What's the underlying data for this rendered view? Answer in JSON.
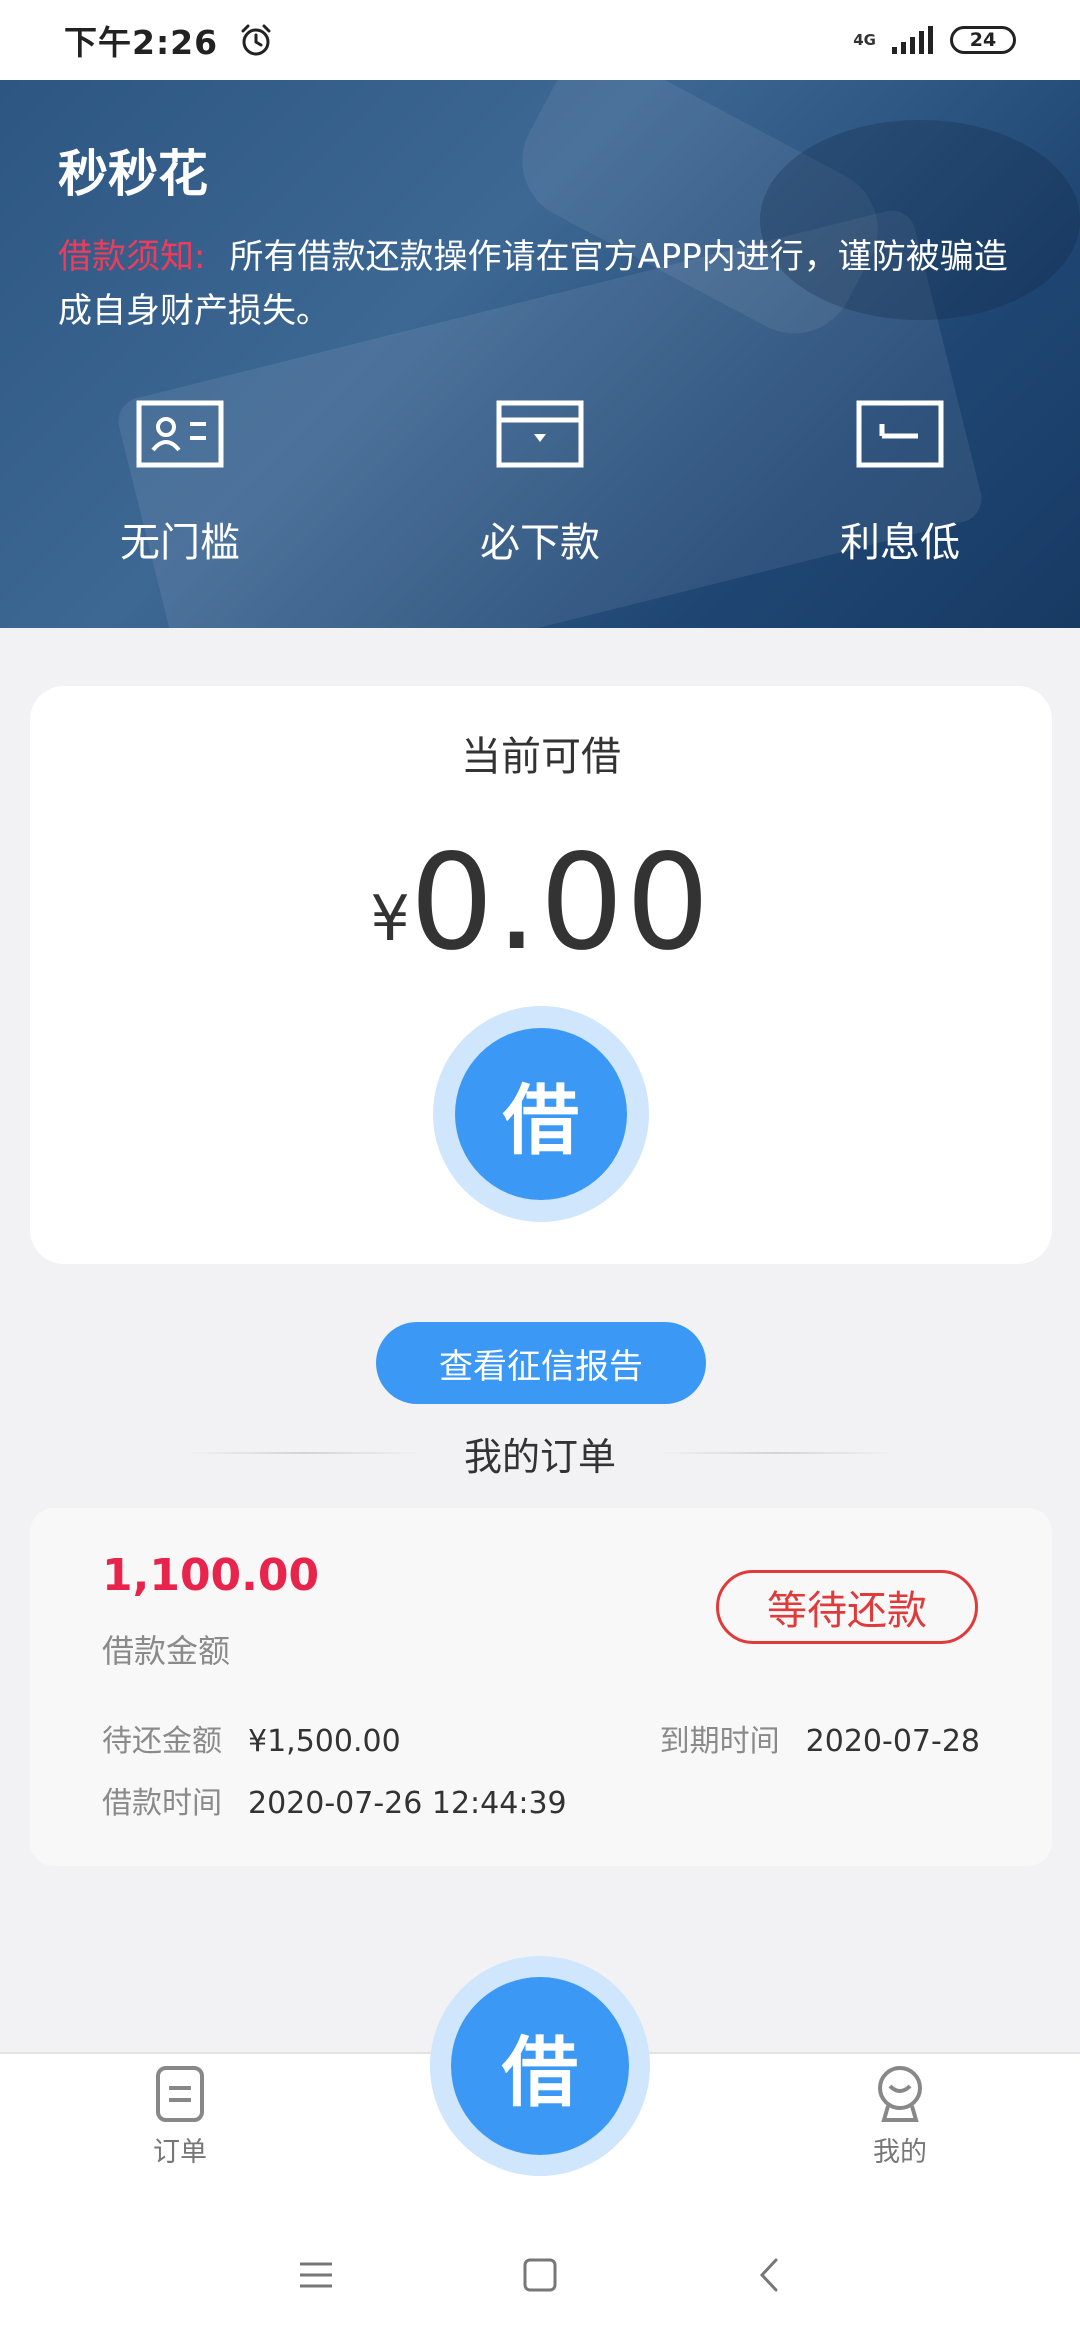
{
  "status_bar": {
    "time": "下午2:26",
    "network": "4G",
    "battery": "24"
  },
  "header": {
    "title": "秒秒花",
    "notice_label": "借款须知:",
    "notice_text": "所有借款还款操作请在官方APP内进行，谨防被骗造成自身财产损失。",
    "features": [
      {
        "label": "无门槛",
        "icon": "id-card-icon"
      },
      {
        "label": "必下款",
        "icon": "wallet-icon"
      },
      {
        "label": "利息低",
        "icon": "card-return-icon"
      }
    ]
  },
  "borrow_card": {
    "title": "当前可借",
    "currency": "¥",
    "amount": "0.00",
    "button_label": "借"
  },
  "credit_report_button": "查看征信报告",
  "orders_section": {
    "title": "我的订单",
    "orders": [
      {
        "amount": "1,100.00",
        "amount_label": "借款金额",
        "status": "等待还款",
        "pending_label": "待还金额",
        "pending_value": "¥1,500.00",
        "due_label": "到期时间",
        "due_value": "2020-07-28",
        "borrow_time_label": "借款时间",
        "borrow_time_value": "2020-07-26 12:44:39"
      }
    ]
  },
  "tab_bar": {
    "orders_label": "订单",
    "center_label": "借",
    "mine_label": "我的"
  },
  "colors": {
    "accent_blue": "#3b99f5",
    "accent_red": "#e8244d",
    "banner_blue": "#2d5683"
  }
}
